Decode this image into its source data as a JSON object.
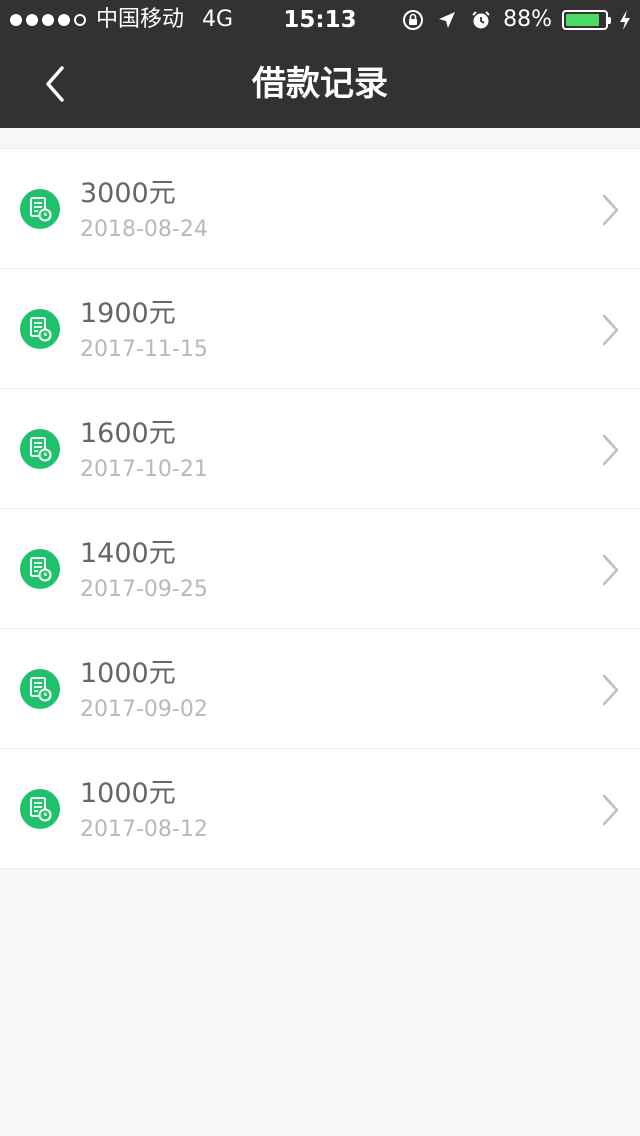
{
  "status_bar": {
    "carrier": "中国移动",
    "network": "4G",
    "time": "15:13",
    "battery_pct": "88%",
    "battery_level": 0.88,
    "signal_bars_filled": 4,
    "icons": [
      "orientation-lock-icon",
      "location-arrow-icon",
      "alarm-icon",
      "battery-icon",
      "charging-icon"
    ]
  },
  "nav": {
    "title": "借款记录",
    "back_icon": "chevron-left-icon"
  },
  "records": [
    {
      "amount": "3000元",
      "date": "2018-08-24"
    },
    {
      "amount": "1900元",
      "date": "2017-11-15"
    },
    {
      "amount": "1600元",
      "date": "2017-10-21"
    },
    {
      "amount": "1400元",
      "date": "2017-09-25"
    },
    {
      "amount": "1000元",
      "date": "2017-09-02"
    },
    {
      "amount": "1000元",
      "date": "2017-08-12"
    }
  ],
  "colors": {
    "header_bg": "#323232",
    "icon_green": "#1ec26a",
    "page_bg": "#f7f7f7",
    "amount_text": "#666666",
    "date_text": "#b9b9b9"
  }
}
